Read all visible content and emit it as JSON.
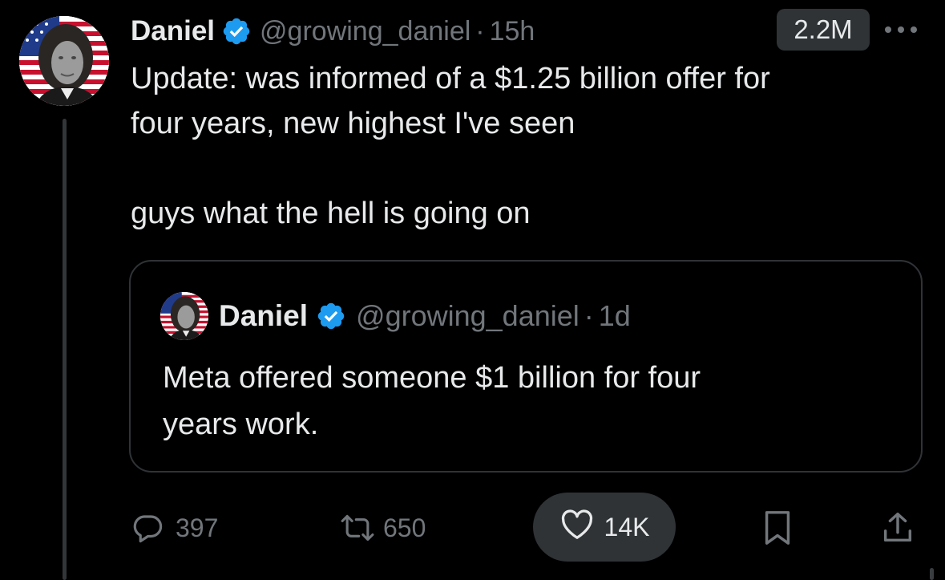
{
  "tweet": {
    "author": {
      "display_name": "Daniel",
      "handle": "@growing_daniel",
      "verified": true
    },
    "separator": "·",
    "time": "15h",
    "views": "2.2M",
    "text_lines": [
      "Update: was informed of a $1.25 billion offer for",
      "four years, new highest I've seen",
      "guys what the hell is going on"
    ],
    "quoted": {
      "author": {
        "display_name": "Daniel",
        "handle": "@growing_daniel",
        "verified": true
      },
      "separator": "·",
      "time": "1d",
      "text_lines": [
        "Meta offered someone $1 billion for four",
        "years work."
      ]
    },
    "actions": {
      "replies": "397",
      "reposts": "650",
      "likes": "14K"
    }
  },
  "icons": {
    "more": "more-horizontal-icon",
    "reply": "reply-bubble-icon",
    "repost": "repost-arrows-icon",
    "like": "heart-icon",
    "bookmark": "bookmark-icon",
    "share": "share-upload-icon",
    "verified": "verified-badge-icon"
  },
  "colors": {
    "background": "#000000",
    "text_primary": "#e7e9ea",
    "text_secondary": "#71767b",
    "verified_blue": "#1d9bf0",
    "border": "#2f3336"
  }
}
